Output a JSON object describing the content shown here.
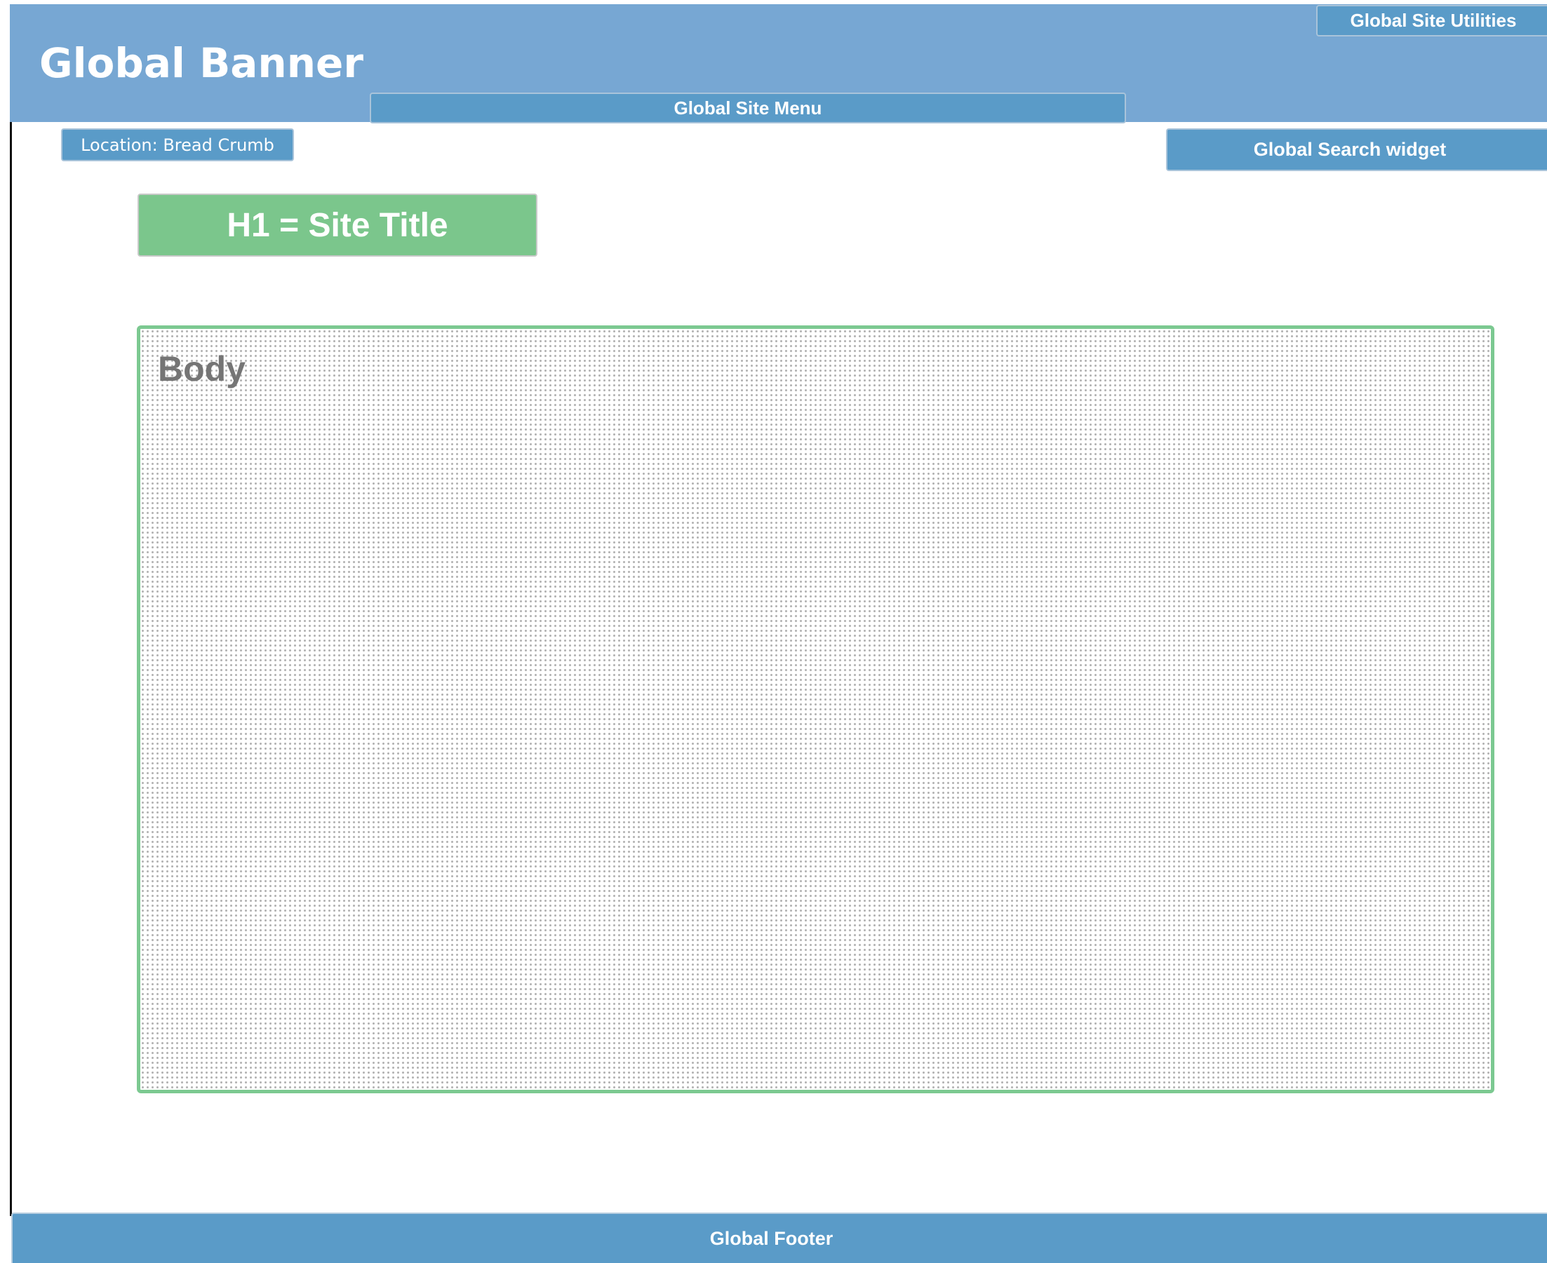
{
  "banner": {
    "title": "Global Banner",
    "utilities_label": "Global Site Utilities",
    "menu_label": "Global Site Menu"
  },
  "breadcrumb": {
    "label": "Location: Bread Crumb"
  },
  "search": {
    "label": "Global Search widget"
  },
  "main": {
    "site_title": "H1 = Site Title",
    "body_label": "Body"
  },
  "footer": {
    "label": "Global Footer"
  },
  "colors": {
    "banner": "#77a7d3",
    "widget_blue": "#5a9bc8",
    "title_green": "#7bc68c",
    "body_border_green": "#7cc991",
    "body_label_gray": "#757575"
  }
}
